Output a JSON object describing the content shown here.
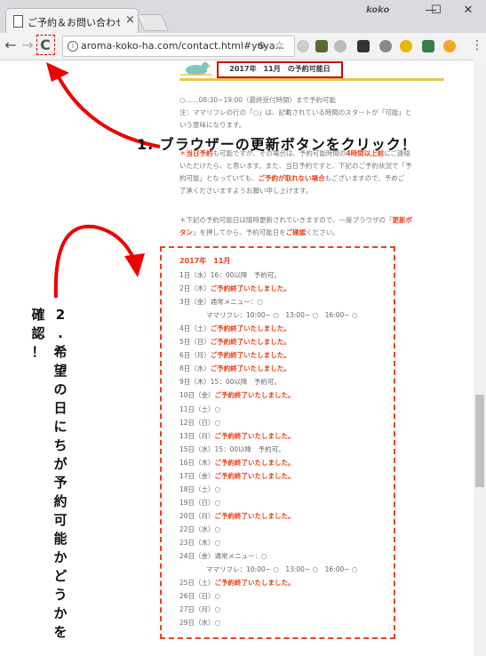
{
  "browser": {
    "tab_title": "ご予約＆お問い合わせ　ア",
    "tab_close": "×",
    "profile_name": "koko",
    "url": "aroma-koko-ha.com/contact.html#yoya...",
    "window_minimize": "—",
    "window_maximize": "☐",
    "window_close": "✕",
    "back": "←",
    "forward": "→",
    "reload": "C",
    "info": "i",
    "zoom_icon": "⊕",
    "star_icon": "☆",
    "menu": "⋮"
  },
  "page": {
    "title": "2017年　11月　の予約可能日",
    "intro_line1": "○……08:30~19:00（最終受付時間）まで予約可能",
    "intro_line2": "注：ママリフレの行の「○」は、記載されている時間のスタートが「可能」と",
    "intro_line3": "いう意味になります。",
    "note1_star": "＊",
    "note1_a": "当日予約",
    "note1_b": "も可能ですが、その場合は、予約可能時間の",
    "note1_c": "4時間以上前",
    "note1_d": "にご連絡",
    "note1_line2": "いただけたら、と思います。また、当日予約ですと、下記のご予約状況で「予",
    "note1_line3a": "約可能」となっていても、",
    "note1_line3b": "ご予約が取れない場合",
    "note1_line3c": "もございますので、予めご",
    "note1_line4": "了承くださいますようお願い申し上げます。",
    "note2_line1a": "＊下記の予約可能日は随時更新されていきますので、一度ブラウザの「",
    "note2_line1b": "更新ボ",
    "note2_line2a": "タン",
    "note2_line2b": "」を押してから、予約可能日を",
    "note2_line2c": "ご確認",
    "note2_line2d": "ください。",
    "schedule_heading": "2017年　11月",
    "schedule": [
      {
        "d": "1日（水）16：00以降　予約可。",
        "s": ""
      },
      {
        "d": "2日（木）",
        "s": "ご予約終了いたしました。"
      },
      {
        "d": "3日（金）通常メニュー：○",
        "s": ""
      },
      {
        "d": "　　　　ママリフレ：10:00~ ○　13:00~ ○　16:00~ ○",
        "s": ""
      },
      {
        "d": "4日（土）",
        "s": "ご予約終了いたしました。"
      },
      {
        "d": "5日（日）",
        "s": "ご予約終了いたしました。"
      },
      {
        "d": "6日（月）",
        "s": "ご予約終了いたしました。"
      },
      {
        "d": "8日（水）",
        "s": "ご予約終了いたしました。"
      },
      {
        "d": "9日（木）15：00以降　予約可。",
        "s": ""
      },
      {
        "d": "10日（金）",
        "s": "ご予約終了いたしました。"
      },
      {
        "d": "11日（土）○",
        "s": ""
      },
      {
        "d": "12日（日）○",
        "s": ""
      },
      {
        "d": "13日（月）",
        "s": "ご予約終了いたしました。"
      },
      {
        "d": "15日（水）15：00以降　予約可。",
        "s": ""
      },
      {
        "d": "16日（木）",
        "s": "ご予約終了いたしました。"
      },
      {
        "d": "17日（金）",
        "s": "ご予約終了いたしました。"
      },
      {
        "d": "18日（土）○",
        "s": ""
      },
      {
        "d": "19日（日）○",
        "s": ""
      },
      {
        "d": "20日（月）",
        "s": "ご予約終了いたしました。"
      },
      {
        "d": "22日（水）○",
        "s": ""
      },
      {
        "d": "23日（木）○",
        "s": ""
      },
      {
        "d": "24日（金）通常メニュー：○",
        "s": ""
      },
      {
        "d": "　　　　ママリフレ：10:00~ ○　13:00~ ○　16:00~ ○",
        "s": ""
      },
      {
        "d": "25日（土）",
        "s": "ご予約終了いたしました。"
      },
      {
        "d": "26日（日）○",
        "s": ""
      },
      {
        "d": "27日（月）○",
        "s": ""
      },
      {
        "d": "29日（水）○",
        "s": ""
      }
    ]
  },
  "annotations": {
    "step1": "1. ブラウザーの更新ボタンをクリック！",
    "step2_col1": "2.希望の日にちが予約可能かどうかを",
    "step2_col2": "確認！"
  },
  "colors": {
    "accent_red": "#e8431b",
    "title_border": "#d80000",
    "divider": "#e8c84a"
  }
}
